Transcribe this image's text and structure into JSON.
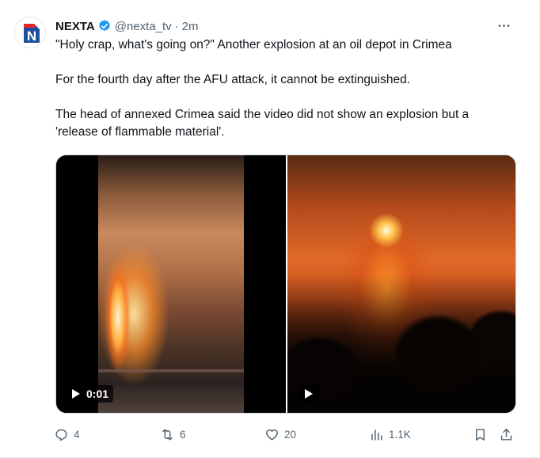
{
  "author": {
    "display_name": "NEXTA",
    "handle": "@nexta_tv",
    "separator": "·",
    "time": "2m",
    "avatar_letter": "N",
    "avatar_icon": "nexta-logo-icon",
    "verified_icon": "verified-badge-icon"
  },
  "menu": {
    "icon": "more-icon"
  },
  "body": {
    "line1": "\"Holy crap, what's going on?\" Another explosion at an oil depot in Crimea",
    "line2": "For the fourth day after the AFU attack, it cannot be extinguished.",
    "line3a": "The head of annexed Crimea said the video did not show an explosion but a",
    "line3b": "'release of flammable material'."
  },
  "media": {
    "video1": {
      "duration": "0:01",
      "icon": "play-icon"
    },
    "video2": {
      "icon": "play-icon"
    }
  },
  "actions": {
    "reply": {
      "count": "4",
      "icon": "reply-icon"
    },
    "retweet": {
      "count": "6",
      "icon": "retweet-icon"
    },
    "like": {
      "count": "20",
      "icon": "heart-icon"
    },
    "views": {
      "count": "1.1K",
      "icon": "views-icon"
    },
    "bookmark": {
      "icon": "bookmark-icon"
    },
    "share": {
      "icon": "share-icon"
    }
  },
  "colors": {
    "text_primary": "#0f1419",
    "text_secondary": "#536471",
    "verified_blue": "#1d9bf0",
    "nexta_red": "#e1252d",
    "nexta_blue": "#1e4f9c"
  }
}
